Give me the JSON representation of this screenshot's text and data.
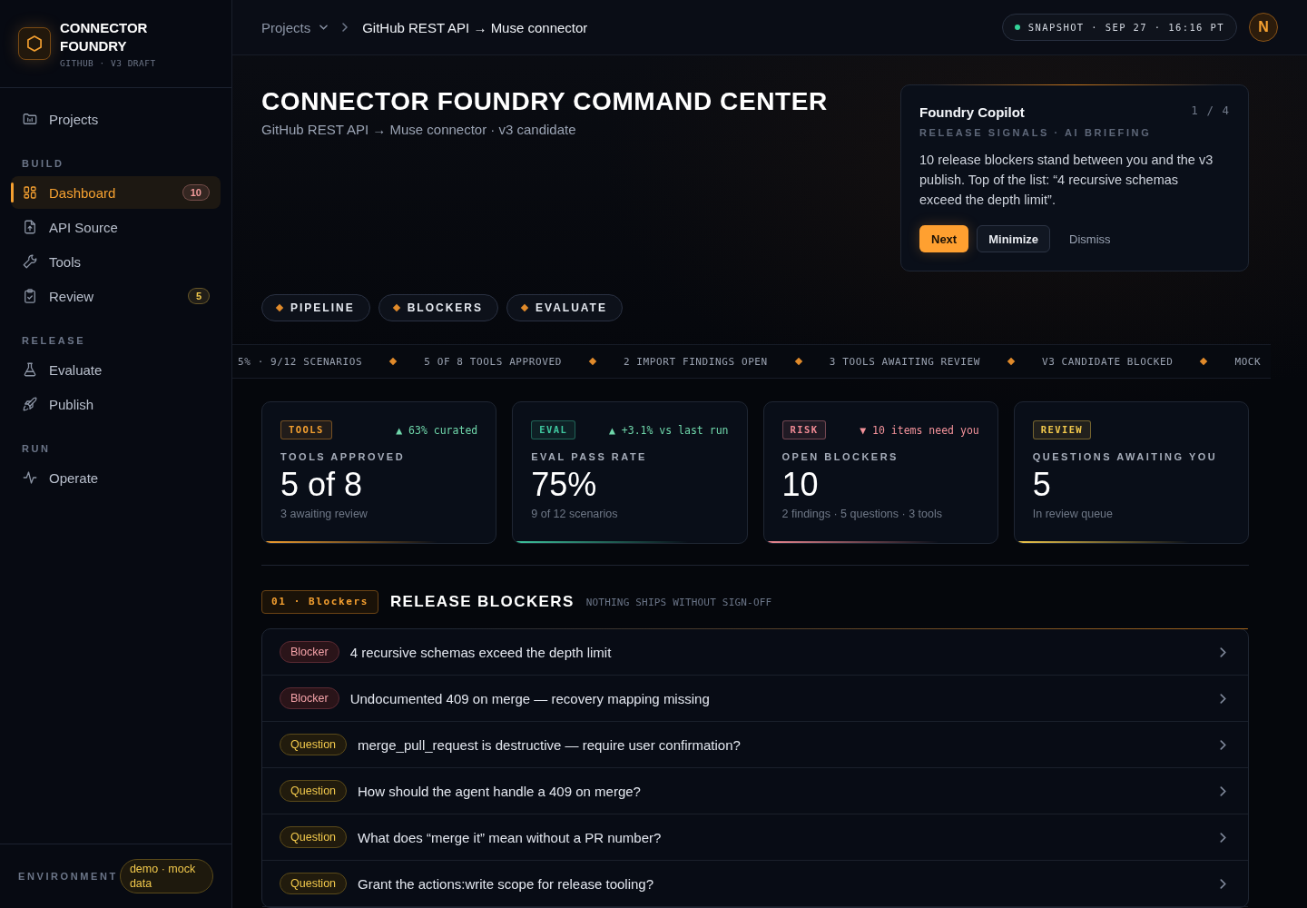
{
  "sidebar": {
    "brand": {
      "title": "CONNECTOR FOUNDRY",
      "subtitle": "GITHUB · V3 DRAFT"
    },
    "nav": [
      {
        "items": [
          {
            "label": "Projects",
            "selected": false
          }
        ]
      },
      {
        "heading": "BUILD",
        "items": [
          {
            "label": "Dashboard",
            "selected": true,
            "badge": {
              "text": "10",
              "color": "#f29b9b"
            }
          },
          {
            "label": "API Source",
            "selected": false
          },
          {
            "label": "Tools",
            "selected": false
          },
          {
            "label": "Review",
            "selected": false,
            "badge": {
              "text": "5",
              "color": "#f2c94c"
            }
          }
        ]
      },
      {
        "heading": "RELEASE",
        "items": [
          {
            "label": "Evaluate",
            "selected": false
          },
          {
            "label": "Publish",
            "selected": false
          }
        ]
      },
      {
        "heading": "RUN",
        "items": [
          {
            "label": "Operate",
            "selected": false
          }
        ]
      }
    ],
    "footer": {
      "label": "ENVIRONMENT",
      "value": "demo · mock data"
    }
  },
  "topbar": {
    "breadcrumb": {
      "root": "Projects",
      "current": "GitHub REST API → Muse connector"
    },
    "snapshot": "SNAPSHOT · SEP 27 · 16:16 PT",
    "user": {
      "initial": "N"
    }
  },
  "header": {
    "title": "CONNECTOR FOUNDRY COMMAND CENTER",
    "subtitle": "GitHub REST API → Muse connector · v3 candidate"
  },
  "copilot": {
    "title": "Foundry Copilot",
    "counter": "1 / 4",
    "subtitle": "RELEASE SIGNALS · AI BRIEFING",
    "message": "10 release blockers stand between you and the v3 publish. Top of the list: “4 recursive schemas exceed the depth limit”.",
    "actions": [
      {
        "label": "Next",
        "kind": "primary"
      },
      {
        "label": "Minimize",
        "kind": "secondary"
      },
      {
        "label": "Dismiss",
        "kind": "ghost"
      }
    ]
  },
  "quick_links": [
    "PIPELINE",
    "BLOCKERS",
    "EVALUATE"
  ],
  "ticker": [
    "5% · 9/12 SCENARIOS",
    "5 OF 8 TOOLS APPROVED",
    "2 IMPORT FINDINGS OPEN",
    "3 TOOLS AWAITING REVIEW",
    "V3 CANDIDATE BLOCKED",
    "MOCK"
  ],
  "stats": [
    {
      "tag": "TOOLS",
      "color": "#f5a030",
      "delta": {
        "text": "▲ 63% curated",
        "up": true
      },
      "label": "TOOLS APPROVED",
      "value": "5 of 8",
      "note": "3 awaiting review"
    },
    {
      "tag": "EVAL",
      "color": "#3fc79f",
      "delta": {
        "text": "▲ +3.1% vs last run",
        "up": true
      },
      "label": "EVAL PASS RATE",
      "value": "75%",
      "note": "9 of 12 scenarios"
    },
    {
      "tag": "RISK",
      "color": "#f08a94",
      "delta": {
        "text": "▼ 10 items need you",
        "up": false
      },
      "label": "OPEN BLOCKERS",
      "value": "10",
      "note": "2 findings · 5 questions · 3 tools"
    },
    {
      "tag": "REVIEW",
      "color": "#f2c94c",
      "label": "QUESTIONS AWAITING YOU",
      "value": "5",
      "note": "In review queue"
    }
  ],
  "blockers": {
    "badge": "01 · Blockers",
    "title": "RELEASE BLOCKERS",
    "subtitle": "NOTHING SHIPS WITHOUT SIGN-OFF",
    "rows": [
      {
        "kind": "blocker",
        "tag": "Blocker",
        "text": "4 recursive schemas exceed the depth limit"
      },
      {
        "kind": "blocker",
        "tag": "Blocker",
        "text": "Undocumented 409 on merge — recovery mapping missing"
      },
      {
        "kind": "question",
        "tag": "Question",
        "text": "merge_pull_request is destructive — require user confirmation?"
      },
      {
        "kind": "question",
        "tag": "Question",
        "text": "How should the agent handle a 409 on merge?"
      },
      {
        "kind": "question",
        "tag": "Question",
        "text": "What does “merge it” mean without a PR number?"
      },
      {
        "kind": "question",
        "tag": "Question",
        "text": "Grant the actions:write scope for release tooling?"
      }
    ]
  }
}
